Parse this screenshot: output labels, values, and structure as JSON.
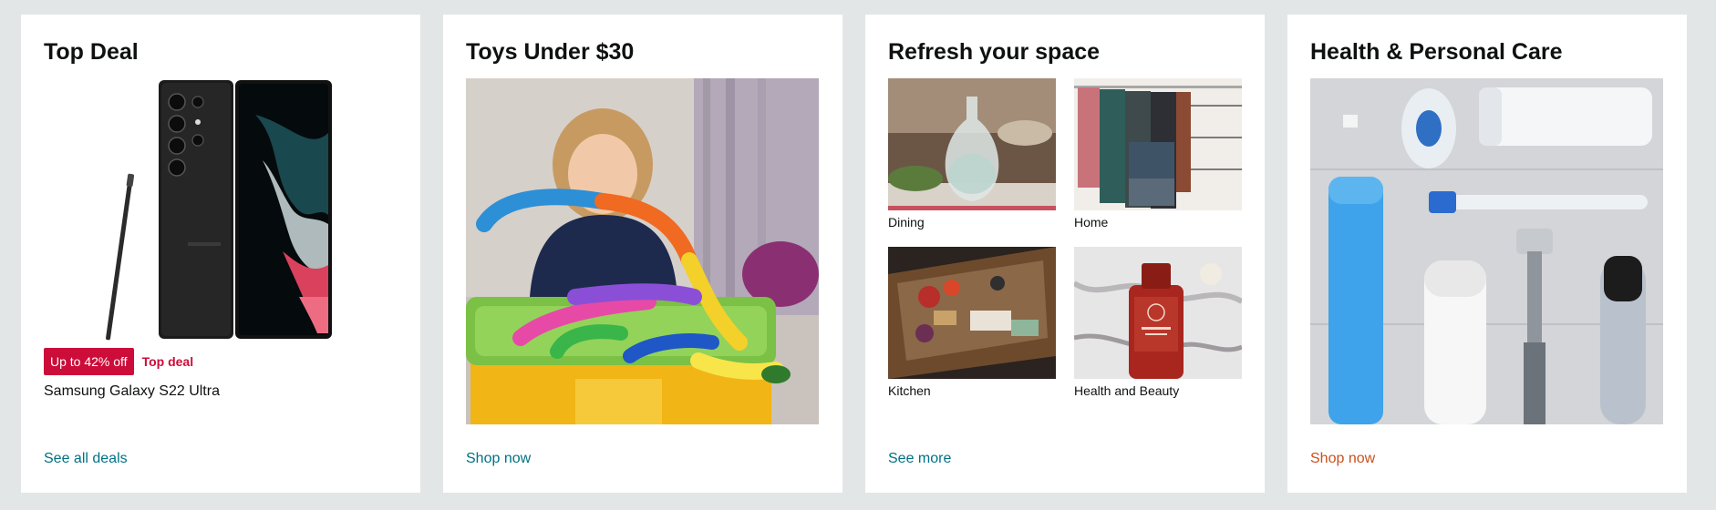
{
  "cards": [
    {
      "title": "Top Deal",
      "badge": "Up to 42% off",
      "deal_label": "Top deal",
      "product_name": "Samsung Galaxy S22 Ultra",
      "link": "See all deals"
    },
    {
      "title": "Toys Under $30",
      "link": "Shop now"
    },
    {
      "title": "Refresh your space",
      "items": [
        {
          "label": "Dining"
        },
        {
          "label": "Home"
        },
        {
          "label": "Kitchen"
        },
        {
          "label": "Health and Beauty"
        }
      ],
      "link": "See more"
    },
    {
      "title": "Health & Personal Care",
      "link": "Shop now"
    }
  ],
  "colors": {
    "page_bg": "#e3e6e6",
    "link": "#007185",
    "link_accent": "#c7511f",
    "deal_red": "#cc0c39"
  }
}
